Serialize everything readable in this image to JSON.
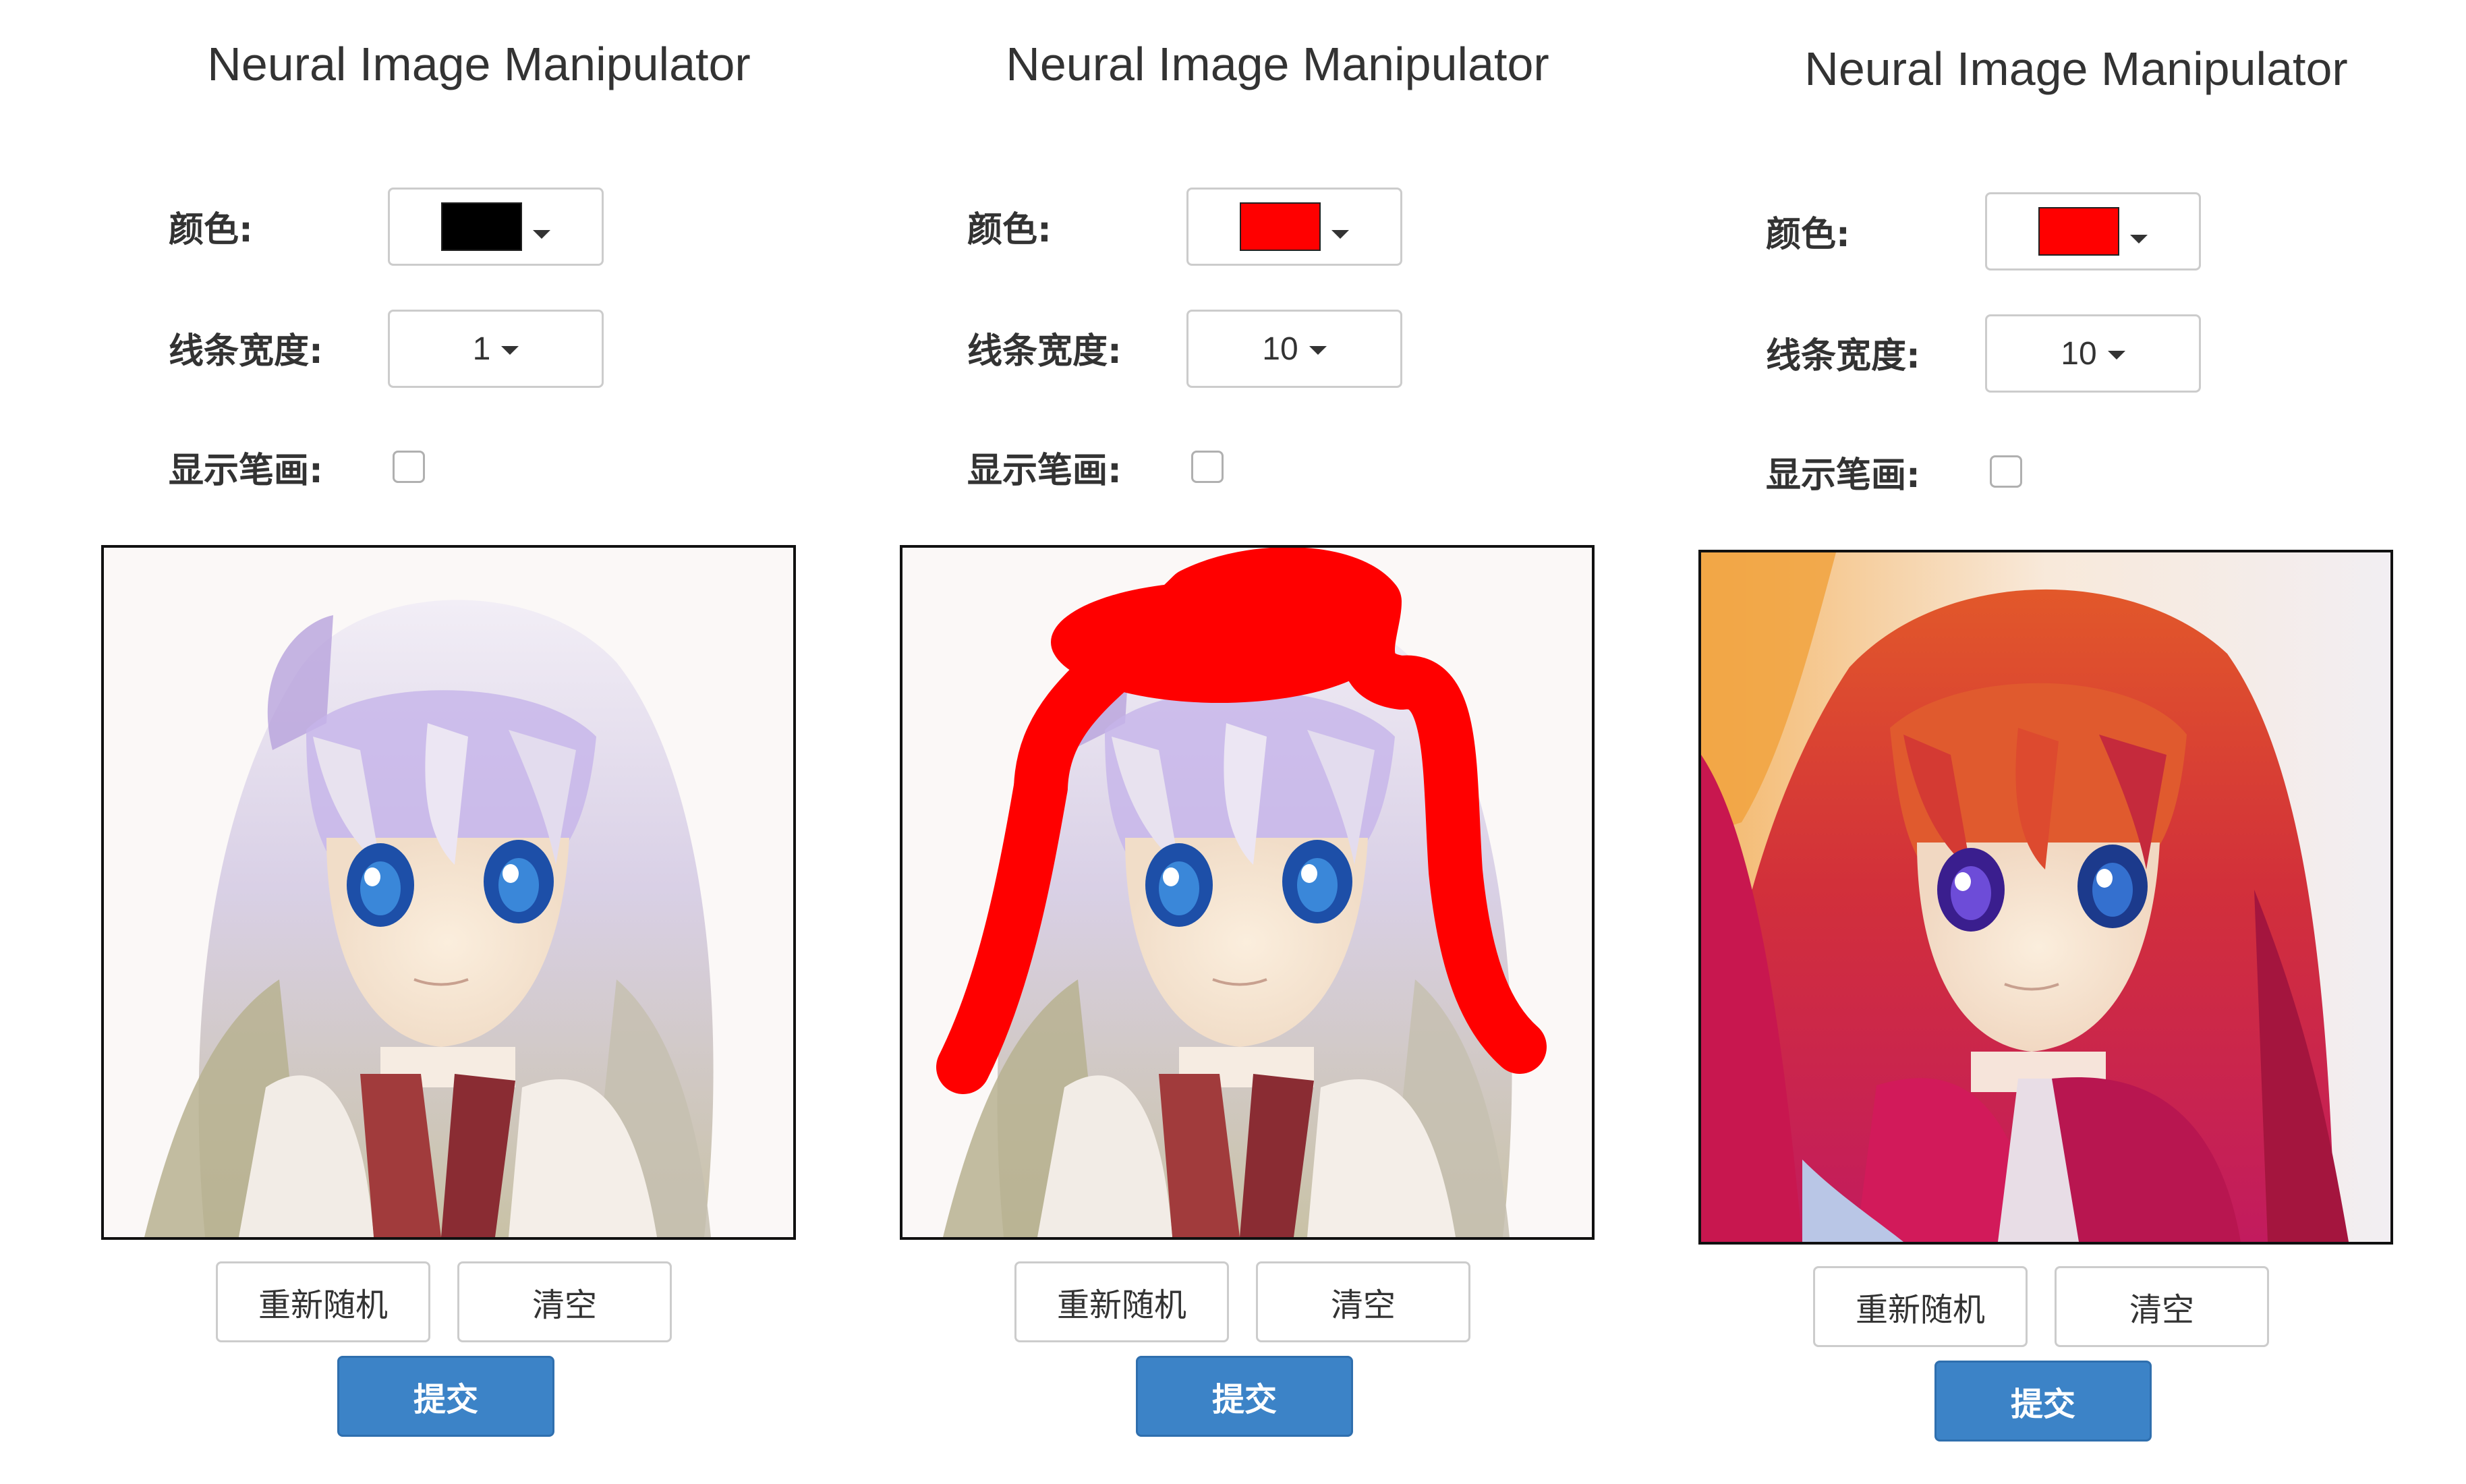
{
  "panels": [
    {
      "title": "Neural Image Manipulator",
      "color_label": "颜色:",
      "color_value": "#000000",
      "width_label": "线条宽度:",
      "width_value": "1",
      "show_strokes_label": "显示笔画:",
      "show_strokes_checked": false,
      "rerandom_label": "重新随机",
      "clear_label": "清空",
      "submit_label": "提交"
    },
    {
      "title": "Neural Image Manipulator",
      "color_label": "颜色:",
      "color_value": "#ff0000",
      "width_label": "线条宽度:",
      "width_value": "10",
      "show_strokes_label": "显示笔画:",
      "show_strokes_checked": false,
      "rerandom_label": "重新随机",
      "clear_label": "清空",
      "submit_label": "提交"
    },
    {
      "title": "Neural Image Manipulator",
      "color_label": "颜色:",
      "color_value": "#ff0000",
      "width_label": "线条宽度:",
      "width_value": "10",
      "show_strokes_label": "显示笔画:",
      "show_strokes_checked": false,
      "rerandom_label": "重新随机",
      "clear_label": "清空",
      "submit_label": "提交"
    }
  ],
  "colors": {
    "primary_button": "#3c83c7",
    "stroke_color": "#ff0000",
    "border": "#cccccc"
  }
}
